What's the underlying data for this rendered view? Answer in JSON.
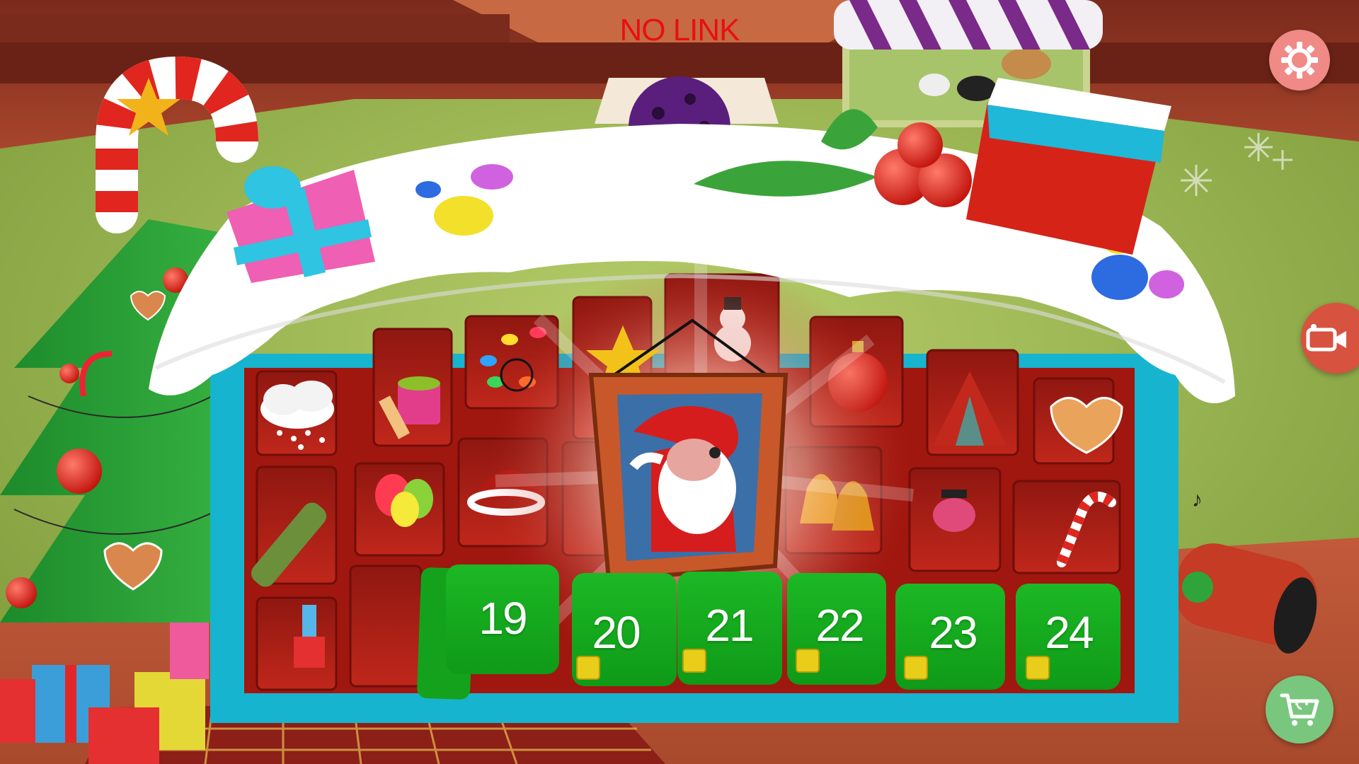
{
  "status": {
    "link_text": "NO LINK"
  },
  "calendar": {
    "closed_doors": [
      {
        "day": "19"
      },
      {
        "day": "20"
      },
      {
        "day": "21"
      },
      {
        "day": "22"
      },
      {
        "day": "23"
      },
      {
        "day": "24"
      }
    ]
  },
  "buttons": {
    "settings_icon": "gear-icon",
    "camera_icon": "video-camera-icon",
    "shop_icon": "shopping-cart-icon"
  },
  "colors": {
    "door_green": "#16a81d",
    "frame_cyan": "#17b4cf",
    "calendar_red": "#b21c14",
    "snow": "#ffffff",
    "no_link_red": "#e81010"
  }
}
